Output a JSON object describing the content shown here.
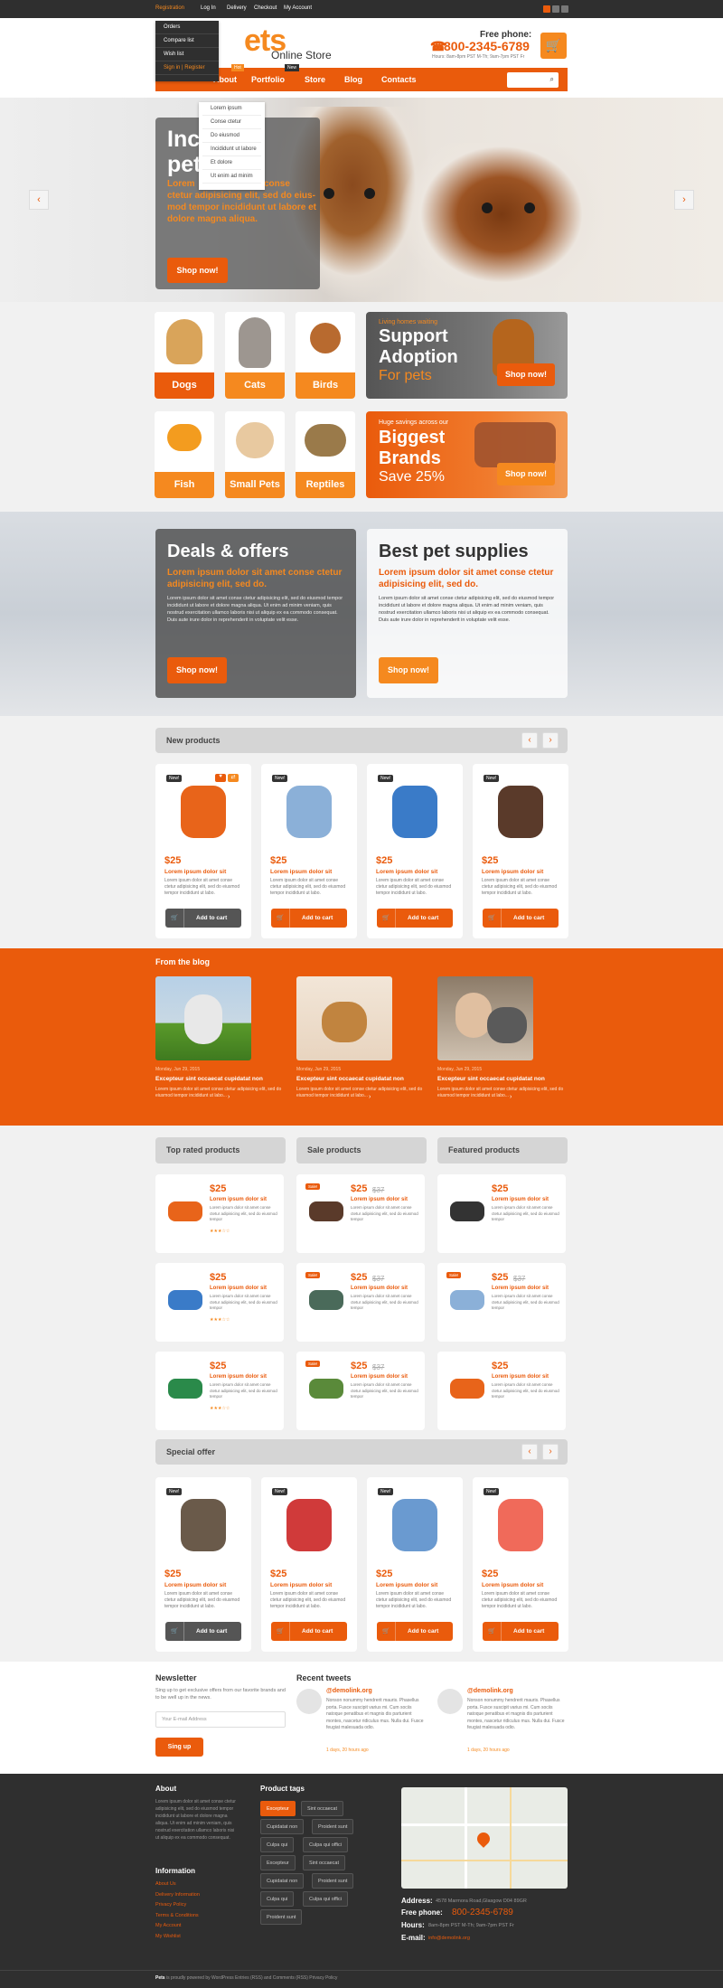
{
  "topbar": {
    "registration": "Registration",
    "login": "Log In",
    "delivery": "Delivery",
    "checkout": "Checkout",
    "account": "My Account"
  },
  "account_menu": [
    "Orders",
    "Compare list",
    "Wish list"
  ],
  "account_sign": "Sign in | Register",
  "header": {
    "logo_main": "ets",
    "logo_sub": "Online Store",
    "phone_label": "Free phone:",
    "phone": "800-2345-6789",
    "hours": "Hours: 8am-8pm PST M-Th; 9am-7pm PST Fr"
  },
  "nav": {
    "items": [
      "About",
      "Portfolio",
      "Store",
      "Blog",
      "Contacts"
    ],
    "hot": "Hot",
    "new": "New"
  },
  "nav_dropdown": [
    "Lorem ipsum",
    "Conse ctetur",
    "Do eiusmod",
    "Incididunt ut labore",
    "Et dolore",
    "Ut enim ad minim"
  ],
  "hero": {
    "title_l1": "Inc",
    "title_l2": "pet",
    "orange_l1": "Lorem",
    "orange_r1": "conse",
    "line3": "ctetur adipisicing elit, sed do eius-",
    "line4": "mod tempor incididunt ut labore et",
    "line5": "dolore magna aliqua.",
    "button": "Shop now!"
  },
  "categories": [
    "Dogs",
    "Cats",
    "Birds",
    "Fish",
    "Small Pets",
    "Reptiles"
  ],
  "promo1": {
    "small": "Living homes waiting",
    "l1": "Support",
    "l2": "Adoption",
    "l3": "For pets",
    "button": "Shop now!"
  },
  "promo2": {
    "small": "Huge savings across our",
    "l1": "Biggest",
    "l2": "Brands",
    "l3": "Save 25%",
    "button": "Shop now!"
  },
  "deals": {
    "title": "Deals & offers",
    "sub": "Lorem ipsum dolor sit amet conse ctetur adipisicing elit, sed do.",
    "text": "Lorem ipsum dolor sit amet conse ctetur adipisicing elit, sed do eiusmod tempor incididunt ut labore et dolore magna aliqua. Ut enim ad minim veniam, quis nostrud exercitation ullamco laboris nisi ut aliquip ex ea commodo consequat. Duis aute irure dolor in reprehenderit in voluptate velit esse.",
    "button": "Shop now!"
  },
  "supplies": {
    "title": "Best pet supplies",
    "sub": "Lorem ipsum dolor sit amet conse ctetur adipisicing elit, sed do.",
    "text": "Lorem ipsum dolor sit amet conse ctetur adipisicing elit, sed do eiusmod tempor incididunt ut labore et dolore magna aliqua. Ut enim ad minim veniam, quis nostrud exercitation ullamco laboris nisi ut aliquip ex ea commodo consequat. Duis aute irure dolor in reprehenderit in voluptate velit esse.",
    "button": "Shop now!"
  },
  "new_products": {
    "title": "New products",
    "badge": "New!",
    "price": "$25",
    "name": "Lorem ipsum dolor sit",
    "desc": "Lorem ipsum dolor sit amet conse ctetur adipisicing elit, sed do eiusmod tempor incididunt ut labo.",
    "cart": "Add to cart"
  },
  "blog": {
    "title": "From the blog",
    "date": "Monday, Jun 29, 2015",
    "post_title": "Excepteur sint occaecat cupidatat non",
    "excerpt": "Lorem ipsum dolor sit amet conse ctetur adipisicing elit, sed do eiusmod tempor incididunt ut labo..."
  },
  "lists": {
    "top_rated": "Top rated products",
    "sale": "Sale products",
    "featured": "Featured products",
    "price": "$25",
    "old_price": "$37",
    "sale_badge": "Sale!",
    "name": "Lorem ipsum dolor sit",
    "desc": "Lorem ipsum dolor sit amet conse ctetur adipisicing elit, sed do eiusmod tempor",
    "stars": "★★★☆☆"
  },
  "special": {
    "title": "Special offer"
  },
  "newsletter": {
    "title": "Newsletter",
    "text": "Sing up to get exclusive offers from our favorite brands and to be well up in the news.",
    "placeholder": "Your E-mail Address",
    "button": "Sing up"
  },
  "tweets": {
    "title": "Recent tweets",
    "handle": "@demolink.org",
    "text": "Nonson nonummy hendrerit mauris. Phasellus porta. Fusce suscipit varius mi. Cum sociis natoque penatibus et magnis dis parturient montes, nascetur ridiculus mus. Nulla dui. Fusce feugiat malesuada odio.",
    "time": "1 days, 20 hours ago"
  },
  "footer": {
    "about_title": "About",
    "about_text": "Lorem ipsum dolor sit amet conse ctetur adipisicing elit, sed do eiusmod tempor incididunt ut labore et dolore magna aliqua. Ut enim ad minim veniam, quis nostrud exercitation ullamco laboris nisi ut aliquip ex ea commodo consequat.",
    "info_title": "Information",
    "info_links": [
      "About Us",
      "Delivery Information",
      "Privacy Policy",
      "Terms & Conditions",
      "My Account",
      "My Wishlist"
    ],
    "tags_title": "Product tags",
    "tags": [
      "Excepteur",
      "Sint occaecat",
      "Cupidatat non",
      "Proident sunt",
      "Culpa qui",
      "Culpa qui offici",
      "Excepteur",
      "Sint occaecat",
      "Cupidatat non",
      "Proident sunt",
      "Culpa qui",
      "Culpa qui offici",
      "Proident sunt"
    ],
    "address_label": "Address:",
    "address": "4578 Marmora Road,Glasgow D04 89GR",
    "phone_label": "Free phone:",
    "phone": "800-2345-6789",
    "hours_label": "Hours:",
    "hours": "8am-8pm PST M-Th; 9am-7pm PST Fr",
    "email_label": "E-mail:",
    "email": "info@demolink.org",
    "copyright_brand": "Pets",
    "copyright": "is proudly powered by WordPress Entries (RSS) and Comments (RSS) Privacy Policy"
  },
  "colors": {
    "accent": "#ea5b0c",
    "accent_light": "#f5891f",
    "dark": "#2f2f2f"
  }
}
